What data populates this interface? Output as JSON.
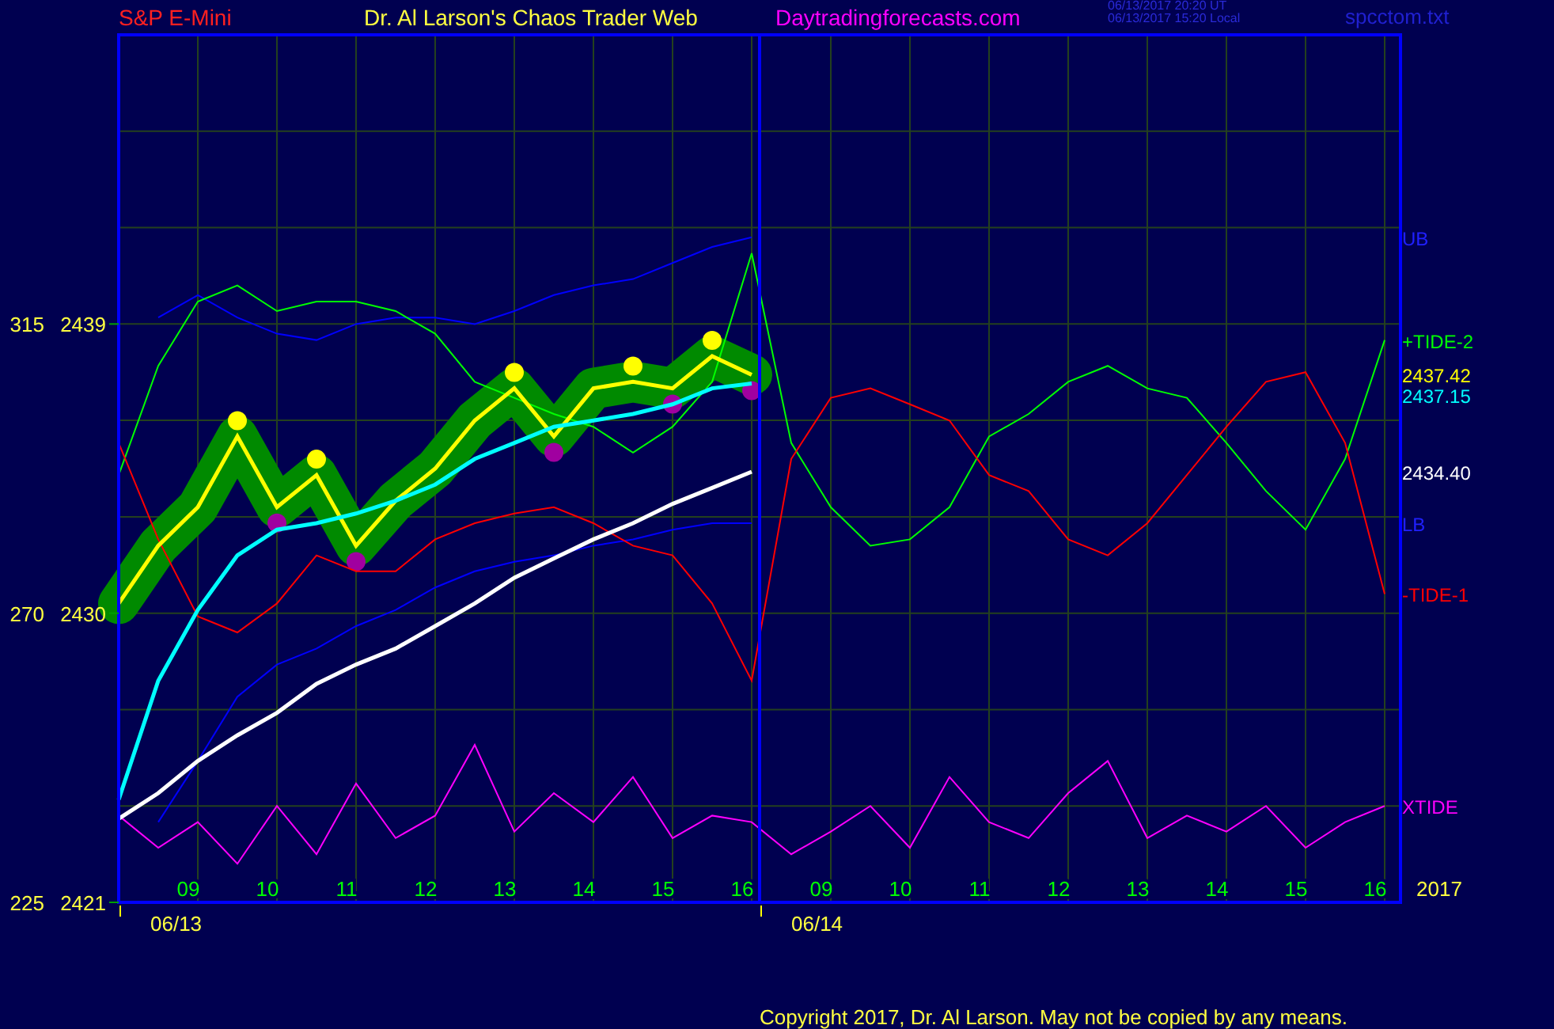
{
  "header": {
    "symbol": "S&P E-Mini",
    "title": "Dr. Al Larson's Chaos Trader Web",
    "site": "Daytradingforecasts.com",
    "timestamps": [
      "06/13/2017 20:20 UT",
      "06/13/2017 15:20 Local"
    ],
    "file": "spcctom.txt"
  },
  "chart": {
    "chart_data": {
      "type": "line",
      "x": [
        8,
        8.5,
        9,
        9.5,
        10,
        10.5,
        11,
        11.5,
        12,
        12.5,
        13,
        13.5,
        14,
        14.5,
        15,
        15.5,
        16,
        16.5,
        17,
        17.5,
        18,
        18.5,
        19,
        19.5,
        20,
        20.5,
        21,
        21.5,
        22,
        22.5,
        23,
        23.5,
        24
      ],
      "xlim": [
        8,
        24.2
      ],
      "ylim": [
        2421,
        2448
      ],
      "xticks": [
        {
          "value": 9,
          "label": "09"
        },
        {
          "value": 10,
          "label": "10"
        },
        {
          "value": 11,
          "label": "11"
        },
        {
          "value": 12,
          "label": "12"
        },
        {
          "value": 13,
          "label": "13"
        },
        {
          "value": 14,
          "label": "14"
        },
        {
          "value": 15,
          "label": "15"
        },
        {
          "value": 16,
          "label": "16"
        }
      ],
      "yticks": [
        {
          "value": 2421,
          "label": "2421"
        },
        {
          "value": 2430,
          "label": "2430"
        },
        {
          "value": 2439,
          "label": "2439"
        }
      ],
      "grid": true,
      "ref_lines": [
        {
          "axis": "x",
          "value": 16.1,
          "color": "#0000ff"
        }
      ],
      "series": [
        {
          "name": "UB",
          "color": "#0000ff",
          "values": [
            null,
            2439.2,
            2439.9,
            2439.2,
            2438.7,
            2438.5,
            2439.0,
            2439.2,
            2439.2,
            2439.0,
            2439.4,
            2439.9,
            2440.2,
            2440.4,
            2440.9,
            2441.4,
            2441.7,
            null,
            null,
            null,
            null,
            null,
            null,
            null,
            null,
            null,
            null,
            null,
            null,
            null,
            null,
            null,
            null
          ]
        },
        {
          "name": "LB",
          "color": "#0000ff",
          "values": [
            null,
            2423.5,
            2425.4,
            2427.4,
            2428.4,
            2428.9,
            2429.6,
            2430.1,
            2430.8,
            2431.3,
            2431.6,
            2431.8,
            2432.1,
            2432.3,
            2432.6,
            2432.8,
            2432.8,
            null,
            null,
            null,
            null,
            null,
            null,
            null,
            null,
            null,
            null,
            null,
            null,
            null,
            null,
            null,
            null
          ]
        },
        {
          "name": "+TIDE-2",
          "color": "#00ff00",
          "values": [
            2434.3,
            2437.7,
            2439.7,
            2440.2,
            2439.4,
            2439.7,
            2439.7,
            2439.4,
            2438.7,
            2437.2,
            2436.7,
            2436.2,
            2435.8,
            2435.0,
            2435.8,
            2437.2,
            2441.2,
            2435.3,
            2433.3,
            2432.1,
            2432.3,
            2433.3,
            2435.5,
            2436.2,
            2437.2,
            2437.7,
            2437.0,
            2436.7,
            2435.3,
            2433.8,
            2432.6,
            2434.8,
            2438.5
          ]
        },
        {
          "name": "-TIDE-1",
          "color": "#ff0000",
          "values": [
            2435.3,
            2432.3,
            2429.9,
            2429.4,
            2430.3,
            2431.8,
            2431.3,
            2431.3,
            2432.3,
            2432.8,
            2433.1,
            2433.3,
            2432.8,
            2432.1,
            2431.8,
            2430.3,
            2427.9,
            2434.8,
            2436.7,
            2437.0,
            2436.5,
            2436.0,
            2434.3,
            2433.8,
            2432.3,
            2431.8,
            2432.8,
            2434.3,
            2435.8,
            2437.2,
            2437.5,
            2435.3,
            2430.6
          ]
        },
        {
          "name": "XTIDE",
          "color": "#ff00ff",
          "values": [
            2423.7,
            2422.7,
            2423.5,
            2422.2,
            2424.0,
            2422.5,
            2424.7,
            2423.0,
            2423.7,
            2425.9,
            2423.2,
            2424.4,
            2423.5,
            2424.9,
            2423.0,
            2423.7,
            2423.5,
            2422.5,
            2423.2,
            2424.0,
            2422.7,
            2424.9,
            2423.5,
            2423.0,
            2424.4,
            2425.4,
            2423.0,
            2423.7,
            2423.2,
            2424.0,
            2422.7,
            2423.5,
            2424.0
          ]
        },
        {
          "name": "2437.42",
          "color": "#ffff00",
          "values": [
            2430.3,
            2432.1,
            2433.3,
            2435.5,
            2433.3,
            2434.3,
            2432.1,
            2433.5,
            2434.5,
            2436.0,
            2437.0,
            2435.5,
            2437.0,
            2437.2,
            2437.0,
            2438.0,
            2437.42,
            null,
            null,
            null,
            null,
            null,
            null,
            null,
            null,
            null,
            null,
            null,
            null,
            null,
            null,
            null,
            null
          ]
        },
        {
          "name": "2437.15",
          "color": "#00ffff",
          "values": [
            2424.2,
            2427.9,
            2430.1,
            2431.8,
            2432.6,
            2432.8,
            2433.1,
            2433.5,
            2434.0,
            2434.8,
            2435.3,
            2435.8,
            2436.0,
            2436.2,
            2436.5,
            2437.0,
            2437.15,
            null,
            null,
            null,
            null,
            null,
            null,
            null,
            null,
            null,
            null,
            null,
            null,
            null,
            null,
            null,
            null
          ]
        },
        {
          "name": "2434.40",
          "color": "#ffffff",
          "values": [
            2423.6,
            2424.4,
            2425.4,
            2426.2,
            2426.9,
            2427.8,
            2428.4,
            2428.9,
            2429.6,
            2430.3,
            2431.1,
            2431.7,
            2432.3,
            2432.8,
            2433.4,
            2433.9,
            2434.4,
            null,
            null,
            null,
            null,
            null,
            null,
            null,
            null,
            null,
            null,
            null,
            null,
            null,
            null,
            null,
            null
          ]
        }
      ]
    },
    "left_scale": [
      "315",
      "270",
      "225"
    ],
    "days": [
      {
        "label": "06/13"
      },
      {
        "label": "06/14",
        "hours": [
          "09",
          "10",
          "11",
          "12",
          "13",
          "14",
          "15",
          "16"
        ]
      }
    ],
    "year": "2017"
  },
  "footer": {
    "copyright": "Copyright 2017, Dr. Al Larson. May not be copied by any means."
  }
}
